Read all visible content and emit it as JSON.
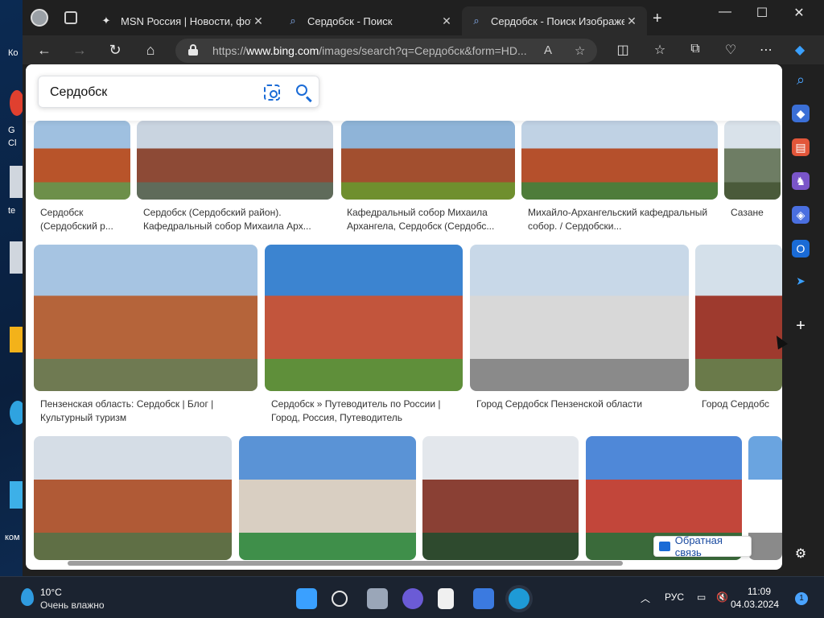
{
  "desktop": {
    "labels": [
      "Ко",
      "G",
      "Cl",
      "te",
      "ком"
    ]
  },
  "tabs": [
    {
      "title": "MSN Россия | Новости, фото, п",
      "active": false,
      "icon": "msn-icon"
    },
    {
      "title": "Сердобск - Поиск",
      "active": false,
      "icon": "bing-search-icon"
    },
    {
      "title": "Сердобск - Поиск Изображен",
      "active": true,
      "icon": "bing-search-icon"
    }
  ],
  "address": {
    "url_prefix": "https://",
    "url_host": "www.bing.com",
    "url_path": "/images/search?q=Сердобск&form=HD..."
  },
  "search": {
    "query": "Сердобск"
  },
  "results": {
    "row1": [
      {
        "caption": "Сердобск (Сердобский р...",
        "colors": [
          "#9fc0e0",
          "#b8542a",
          "#6d8f4a"
        ]
      },
      {
        "caption": "Сердобск (Сердобский район). Кафедральный собор Михаила Арх...",
        "colors": [
          "#c9d4e0",
          "#8d4a36",
          "#5f6b5a"
        ]
      },
      {
        "caption": "Кафедральный собор Михаила Архангела, Сердобск (Сердобс...",
        "colors": [
          "#8fb4d8",
          "#a24f2f",
          "#6f8f2e"
        ]
      },
      {
        "caption": "Михайло-Архангельский кафедральный собор. / Сердобски...",
        "colors": [
          "#c0d2e4",
          "#b5502c",
          "#4e7c3a"
        ]
      },
      {
        "caption": "Сазане",
        "colors": [
          "#d9e2ea",
          "#6e7d64",
          "#4a5a3a"
        ]
      }
    ],
    "row2": [
      {
        "caption": "Пензенская область: Сердобск | Блог | Культурный туризм",
        "colors": [
          "#a6c4e2",
          "#b5643a",
          "#6f7a52"
        ]
      },
      {
        "caption": "Сердобск » Путеводитель по России | Город, Россия, Путеводитель",
        "colors": [
          "#3c84d0",
          "#c2553c",
          "#5f8f3a"
        ]
      },
      {
        "caption": "Город Сердобск Пензенской области",
        "colors": [
          "#c8d8e8",
          "#d8d8d8",
          "#8a8a8a"
        ]
      },
      {
        "caption": "Город Сердобс",
        "colors": [
          "#d4e0ea",
          "#9e3a2e",
          "#6a7a4a"
        ]
      }
    ],
    "row3": [
      {
        "caption": "",
        "colors": [
          "#d5dde6",
          "#b05a36",
          "#5f6f45"
        ]
      },
      {
        "caption": "",
        "colors": [
          "#5a93d6",
          "#d9cfc2",
          "#3f8f4a"
        ]
      },
      {
        "caption": "",
        "colors": [
          "#e3e7ec",
          "#8a4034",
          "#2e4a2e"
        ]
      },
      {
        "caption": "",
        "colors": [
          "#4f88d8",
          "#c2463a",
          "#3a6a3a"
        ]
      },
      {
        "caption": "",
        "colors": [
          "#6aa4e0",
          "#ffffff",
          "#8a8a8a"
        ]
      }
    ]
  },
  "feedback_label": "Обратная связь",
  "taskbar": {
    "temperature": "10°C",
    "weather": "Очень влажно",
    "language": "РУС",
    "time": "11:09",
    "date": "04.03.2024",
    "notifications": "1"
  },
  "colors": {
    "accent": "#1a6bd6",
    "browser_chrome": "#202020",
    "taskbar": "#1b2330"
  }
}
